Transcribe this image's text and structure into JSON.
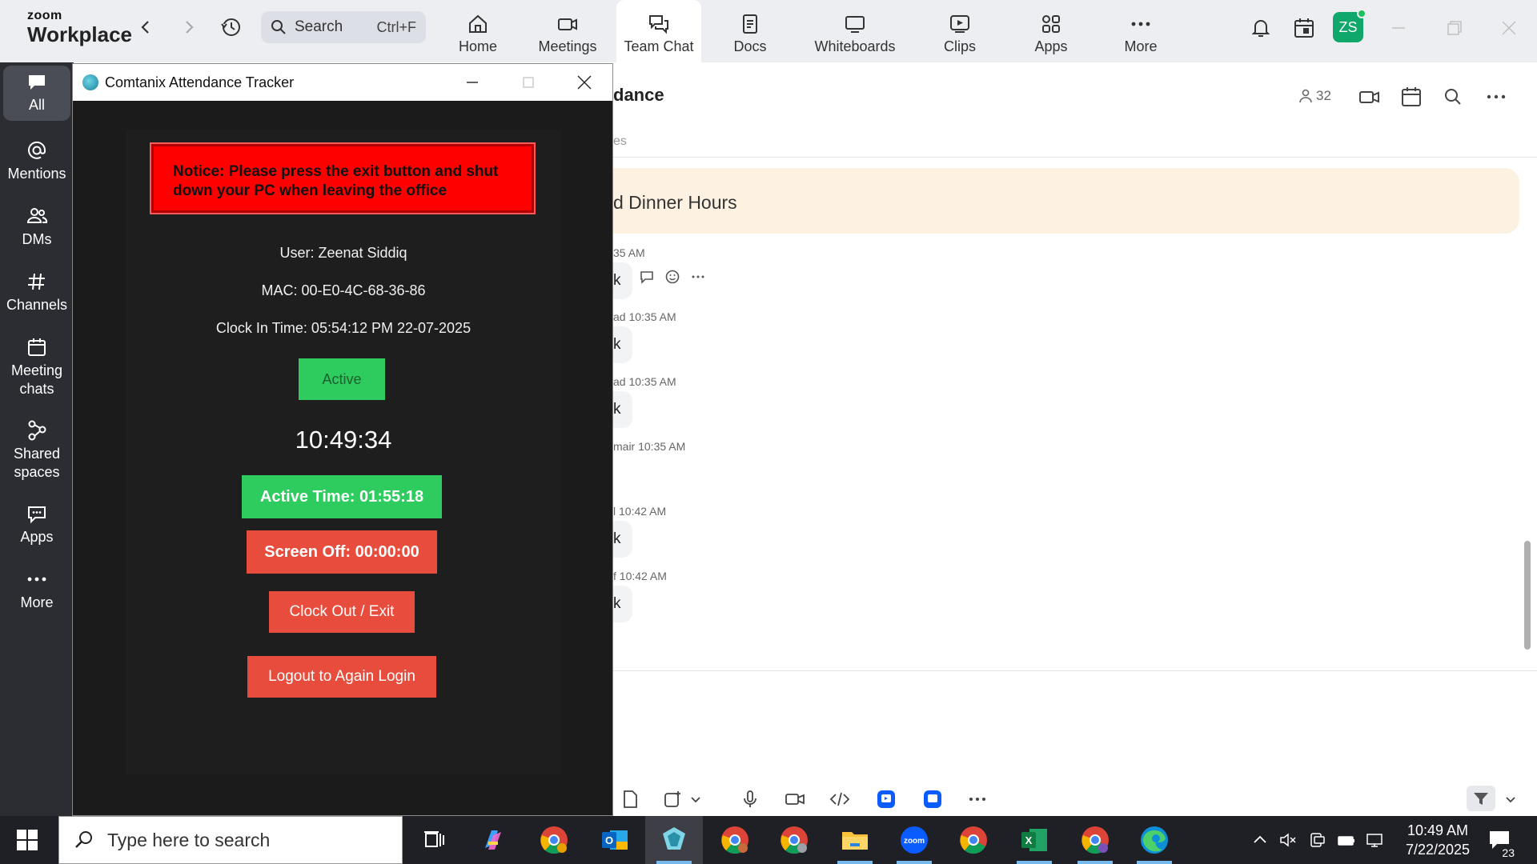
{
  "zoom": {
    "logo_small": "zoom",
    "logo_big": "Workplace",
    "search": {
      "label": "Search",
      "shortcut": "Ctrl+F"
    },
    "tabs": [
      {
        "label": "Home",
        "icon": "home-icon"
      },
      {
        "label": "Meetings",
        "icon": "video-camera-icon"
      },
      {
        "label": "Team Chat",
        "icon": "chat-bubbles-icon"
      },
      {
        "label": "Docs",
        "icon": "document-icon"
      },
      {
        "label": "Whiteboards",
        "icon": "whiteboard-icon"
      },
      {
        "label": "Clips",
        "icon": "clips-icon"
      },
      {
        "label": "Apps",
        "icon": "apps-icon"
      },
      {
        "label": "More",
        "icon": "more-dots-icon"
      }
    ],
    "avatar_initials": "ZS",
    "sidebar": [
      {
        "label": "All",
        "icon": "chat-bubble-icon"
      },
      {
        "label": "Mentions",
        "icon": "at-sign-icon"
      },
      {
        "label": "DMs",
        "icon": "people-icon"
      },
      {
        "label": "Channels",
        "icon": "hash-icon"
      },
      {
        "label": "Meeting\nchats",
        "icon": "calendar-icon"
      },
      {
        "label": "Shared\nspaces",
        "icon": "shared-spaces-icon"
      },
      {
        "label": "Apps",
        "icon": "apps-chat-icon"
      },
      {
        "label": "More",
        "icon": "more-dots-icon"
      }
    ],
    "chat": {
      "title_fragment": "dance",
      "subtab_fragment": "es",
      "member_count": "32",
      "pinned_fragment": "d Dinner Hours",
      "messages": [
        {
          "time": "35 AM",
          "text": "k"
        },
        {
          "time": "ad 10:35 AM",
          "text": "k"
        },
        {
          "time": "ad 10:35 AM",
          "text": "k"
        },
        {
          "time": "mair 10:35 AM",
          "text": ""
        },
        {
          "time": "l 10:42 AM",
          "text": "k"
        },
        {
          "time": "f 10:42 AM",
          "text": "k"
        }
      ]
    }
  },
  "tracker": {
    "window_title": "Comtanix Attendance Tracker",
    "notice": "Notice: Please press the exit button and shut down your PC when leaving the office",
    "user_line": "User: Zeenat Siddiq",
    "mac_line": "MAC: 00-E0-4C-68-36-86",
    "clock_in_line": "Clock In Time: 05:54:12 PM 22-07-2025",
    "status": "Active",
    "clock": "10:49:34",
    "active_time": "Active Time: 01:55:18",
    "screen_off": "Screen Off: 00:00:00",
    "clock_out_button": "Clock Out / Exit",
    "logout_button": "Logout to Again Login",
    "colors": {
      "green": "#2ecc5e",
      "red": "#e74c3c",
      "notice_red": "#ff0000"
    }
  },
  "taskbar": {
    "search_placeholder": "Type here to search",
    "time": "10:49 AM",
    "date": "7/22/2025",
    "notification_count": "23"
  }
}
